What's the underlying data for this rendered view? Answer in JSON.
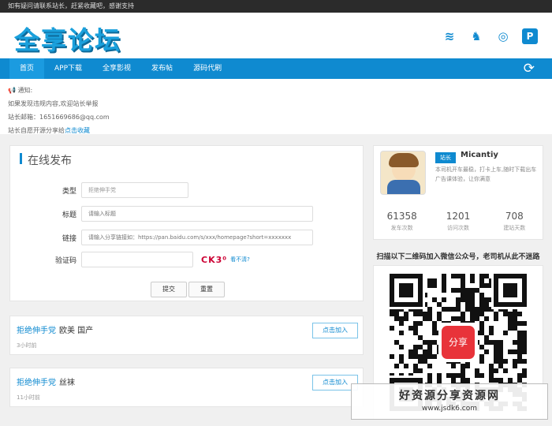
{
  "topbar": {
    "text": "如有疑问请联系站长，赶紧收藏吧，感谢支持"
  },
  "header": {
    "logo": "全享论坛"
  },
  "social": {
    "rss": "≋",
    "qq": "♞",
    "weibo": "◎",
    "pinterest": "P"
  },
  "nav": {
    "items": [
      "首页",
      "APP下载",
      "全享影视",
      "发布帖",
      "源码代刷"
    ],
    "refresh_icon": "⟳"
  },
  "notice": {
    "line1": "📢 通知:",
    "line2": "如果发现违规内容,欢迎站长举报",
    "line3": "站长邮箱：1651669686@qq.com",
    "line4_prefix": "站长自愿开源分享给",
    "line4_link": "点击收藏"
  },
  "publish": {
    "title": "在线发布",
    "type_label": "类型",
    "type_value": "拒绝伸手党",
    "title_label": "标题",
    "title_placeholder": "请输入标题",
    "link_label": "链接",
    "link_placeholder": "请输入分享链接如：https://pan.baidu.com/s/xxx/homepage?short=xxxxxxx",
    "captcha_label": "验证码",
    "captcha_text": "CK3⁰",
    "captcha_refresh": "看不清?",
    "submit": "提交",
    "reset": "重置"
  },
  "posts": [
    {
      "user": "拒绝伸手党",
      "title": "欧美 国产",
      "time": "3小时前",
      "join": "点击加入"
    },
    {
      "user": "拒绝伸手党",
      "title": "丝袜",
      "time": "11小时前",
      "join": "点击加入"
    }
  ],
  "profile": {
    "badge": "站长",
    "name": "Micantiy",
    "bio": "本司机开车最稳，打卡上车,随时下载出车广告课体验，让你满意",
    "stats": [
      {
        "n": "61358",
        "l": "发车次数"
      },
      {
        "n": "1201",
        "l": "访问次数"
      },
      {
        "n": "708",
        "l": "建站天数"
      }
    ]
  },
  "qr": {
    "title": "扫描以下二维码加入微信公众号，老司机从此不迷路",
    "logo_text": "分享"
  },
  "watermark": {
    "line1": "好资源分享资源网",
    "line2": "www.jsdk6.com"
  },
  "colors": {
    "accent": "#0f8ad0",
    "topbar": "#2b2b2b"
  }
}
